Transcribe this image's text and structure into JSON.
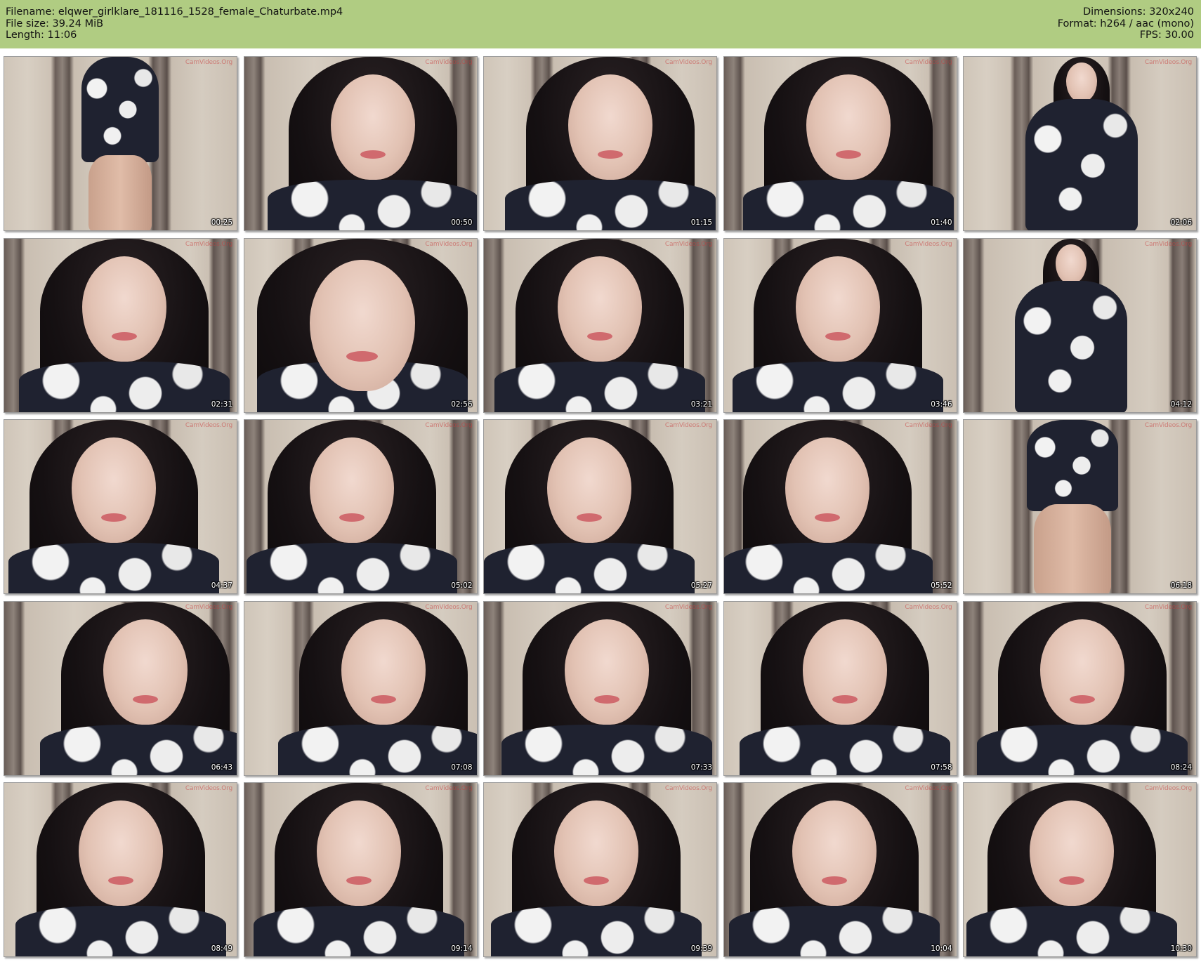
{
  "header": {
    "filename_label": "Filename:",
    "filename": "elqwer_girlklare_181116_1528_female_Chaturbate.mp4",
    "filesize_label": "File size:",
    "filesize": "39.24 MiB",
    "length_label": "Length:",
    "length": "11:06",
    "dimensions_label": "Dimensions:",
    "dimensions": "320x240",
    "format_label": "Format:",
    "format": "h264 / aac (mono)",
    "fps_label": "FPS:",
    "fps": "30.00"
  },
  "watermark": "CamVideos.Org",
  "colors": {
    "header_bg": "#b0cc82",
    "timestamp": "#ffffff"
  },
  "thumbnails": [
    {
      "time": "00:25",
      "pose": "body-closeup"
    },
    {
      "time": "00:50",
      "pose": "face"
    },
    {
      "time": "01:15",
      "pose": "face"
    },
    {
      "time": "01:40",
      "pose": "face"
    },
    {
      "time": "02:06",
      "pose": "full-body"
    },
    {
      "time": "02:31",
      "pose": "face"
    },
    {
      "time": "02:56",
      "pose": "face-close"
    },
    {
      "time": "03:21",
      "pose": "face"
    },
    {
      "time": "03:46",
      "pose": "face"
    },
    {
      "time": "04:12",
      "pose": "full-body"
    },
    {
      "time": "04:37",
      "pose": "face"
    },
    {
      "time": "05:02",
      "pose": "face"
    },
    {
      "time": "05:27",
      "pose": "face"
    },
    {
      "time": "05:52",
      "pose": "face"
    },
    {
      "time": "06:18",
      "pose": "legs"
    },
    {
      "time": "06:43",
      "pose": "face-side"
    },
    {
      "time": "07:08",
      "pose": "face-side"
    },
    {
      "time": "07:33",
      "pose": "face"
    },
    {
      "time": "07:58",
      "pose": "face"
    },
    {
      "time": "08:24",
      "pose": "face"
    },
    {
      "time": "08:49",
      "pose": "face"
    },
    {
      "time": "09:14",
      "pose": "face"
    },
    {
      "time": "09:39",
      "pose": "face"
    },
    {
      "time": "10:04",
      "pose": "face"
    },
    {
      "time": "10:30",
      "pose": "face"
    }
  ]
}
